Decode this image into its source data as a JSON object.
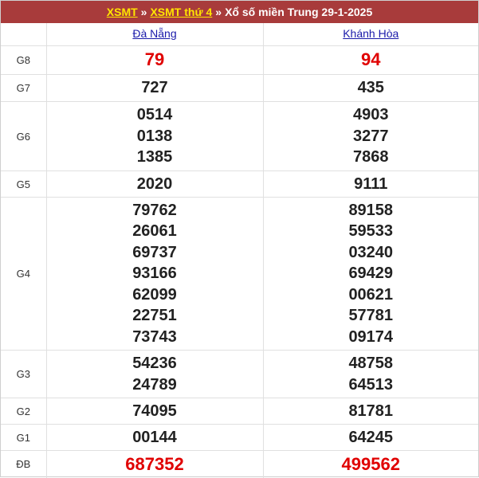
{
  "header": {
    "link1": "XSMT",
    "sep1": "»",
    "link2": "XSMT thứ 4",
    "sep2": "»",
    "title": "Xổ số miền Trung 29-1-2025"
  },
  "provinces": [
    "Đà Nẵng",
    "Khánh Hòa"
  ],
  "colors": {
    "header_bg": "#a83b3b",
    "link_yellow": "#ffe500",
    "special_red": "#e00000"
  },
  "prizes": [
    {
      "label": "G8",
      "values": [
        [
          "79"
        ],
        [
          "94"
        ]
      ],
      "red": true
    },
    {
      "label": "G7",
      "values": [
        [
          "727"
        ],
        [
          "435"
        ]
      ]
    },
    {
      "label": "G6",
      "values": [
        [
          "0514",
          "0138",
          "1385"
        ],
        [
          "4903",
          "3277",
          "7868"
        ]
      ]
    },
    {
      "label": "G5",
      "values": [
        [
          "2020"
        ],
        [
          "9111"
        ]
      ]
    },
    {
      "label": "G4",
      "values": [
        [
          "79762",
          "26061",
          "69737",
          "93166",
          "62099",
          "22751",
          "73743"
        ],
        [
          "89158",
          "59533",
          "03240",
          "69429",
          "00621",
          "57781",
          "09174"
        ]
      ]
    },
    {
      "label": "G3",
      "values": [
        [
          "54236",
          "24789"
        ],
        [
          "48758",
          "64513"
        ]
      ]
    },
    {
      "label": "G2",
      "values": [
        [
          "74095"
        ],
        [
          "81781"
        ]
      ]
    },
    {
      "label": "G1",
      "values": [
        [
          "00144"
        ],
        [
          "64245"
        ]
      ]
    },
    {
      "label": "ĐB",
      "values": [
        [
          "687352"
        ],
        [
          "499562"
        ]
      ],
      "red": true
    }
  ]
}
